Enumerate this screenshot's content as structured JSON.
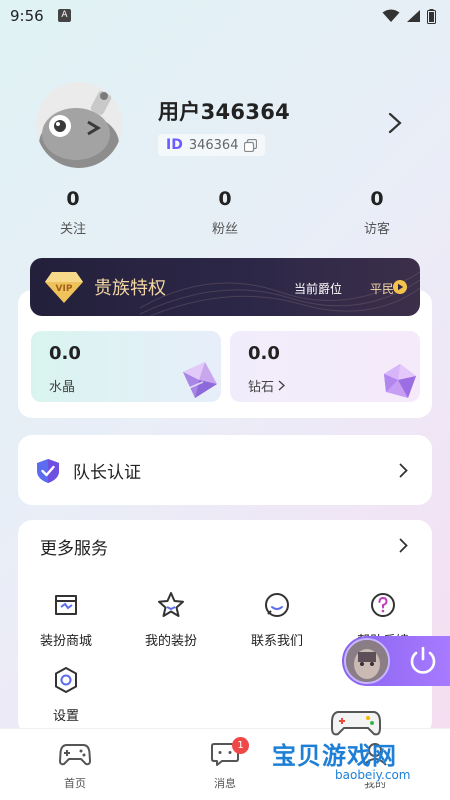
{
  "status_bar": {
    "time": "9:56",
    "indicator": "A"
  },
  "profile": {
    "username": "用户346364",
    "id_badge": "ID",
    "id_value": "346364"
  },
  "stats": [
    {
      "value": "0",
      "label": "关注"
    },
    {
      "value": "0",
      "label": "粉丝"
    },
    {
      "value": "0",
      "label": "访客"
    }
  ],
  "noble": {
    "badge": "VIP",
    "title": "贵族特权",
    "rank_label": "当前爵位",
    "rank": "平民"
  },
  "wallet": {
    "crystal": {
      "value": "0.0",
      "label": "水晶"
    },
    "diamond": {
      "value": "0.0",
      "label": "钻石"
    }
  },
  "captain": {
    "label": "队长认证"
  },
  "services": {
    "title": "更多服务",
    "items": [
      {
        "label": "装扮商城",
        "icon": "shop-icon"
      },
      {
        "label": "我的装扮",
        "icon": "star-icon"
      },
      {
        "label": "联系我们",
        "icon": "chat-icon"
      },
      {
        "label": "帮助反馈",
        "icon": "help-icon"
      },
      {
        "label": "设置",
        "icon": "settings-icon"
      }
    ]
  },
  "bottom_nav": {
    "items": [
      {
        "label": "首页",
        "icon": "gamepad-icon"
      },
      {
        "label": "消息",
        "icon": "message-icon",
        "badge": "1"
      },
      {
        "label": "我的",
        "icon": "profile-icon"
      }
    ]
  },
  "watermark": {
    "title": "宝贝游戏网",
    "url": "baobeiy.com"
  },
  "colors": {
    "accent": "#6b5cff",
    "noble_gold": "#f3d6a3",
    "float_widget": "#9a70ff",
    "badge_red": "#f04848",
    "watermark_blue": "#1e7fd6"
  }
}
